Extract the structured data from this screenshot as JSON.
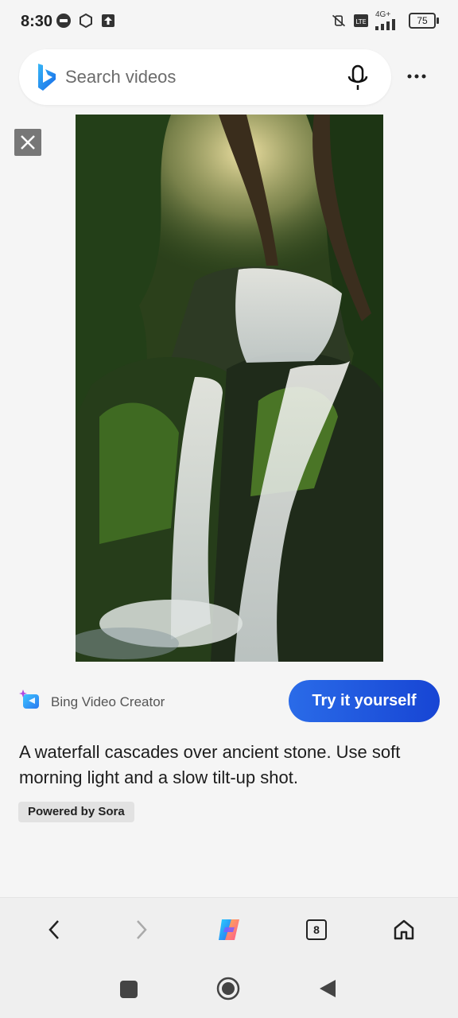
{
  "status_bar": {
    "time": "8:30",
    "left_icons": [
      "line-app-icon",
      "notification-icon",
      "upload-icon"
    ],
    "right_icons": [
      "vibrate-off-icon",
      "volte-icon",
      "signal-4g-icon"
    ],
    "network_label": "4G+",
    "battery": "75"
  },
  "search": {
    "placeholder": "Search videos"
  },
  "video": {
    "description": "A waterfall cascades over ancient stone. Use soft morning light and a slow tilt-up shot."
  },
  "creator": {
    "label": "Bing Video Creator",
    "try_button": "Try it yourself",
    "powered_by": "Powered by Sora"
  },
  "bottom_nav": {
    "tabs_count": "8"
  },
  "colors": {
    "accent": "#1f5ae0",
    "background": "#f5f5f5"
  }
}
